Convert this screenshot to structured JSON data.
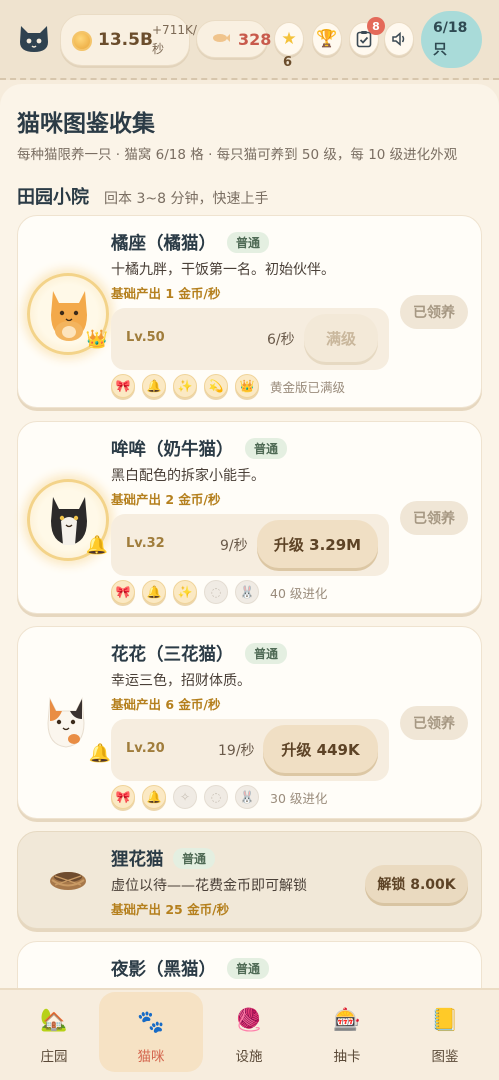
{
  "topbar": {
    "coins": "13.5B",
    "coin_rate_line1": "+711K/",
    "coin_rate_line2": "秒",
    "fish": "328",
    "star_count": "6",
    "task_badge": "8",
    "cattery_line1": "6/18",
    "cattery_line2": "只"
  },
  "page": {
    "title": "猫咪图鉴收集",
    "subtitle": "每种猫限养一只 · 猫窝 6/18 格 · 每只猫可养到 50 级，每 10 级进化外观"
  },
  "section": {
    "title": "田园小院",
    "subtitle": "回本 3~8 分钟，快速上手"
  },
  "cards": [
    {
      "name": "橘座（橘猫）",
      "tag": "普通",
      "desc": "十橘九胖，干饭第一名。初始伙伴。",
      "prod": "基础产出 1 金币/秒",
      "level": "Lv.50",
      "rate": "6/秒",
      "upgrade": "满级",
      "side": "已领养",
      "evo_note": "黄金版已满级"
    },
    {
      "name": "哞哞（奶牛猫）",
      "tag": "普通",
      "desc": "黑白配色的拆家小能手。",
      "prod": "基础产出 2 金币/秒",
      "level": "Lv.32",
      "rate": "9/秒",
      "upgrade": "升级 3.29M",
      "side": "已领养",
      "evo_note": "40 级进化"
    },
    {
      "name": "花花（三花猫）",
      "tag": "普通",
      "desc": "幸运三色，招财体质。",
      "prod": "基础产出 6 金币/秒",
      "level": "Lv.20",
      "rate": "19/秒",
      "upgrade": "升级 449K",
      "side": "已领养",
      "evo_note": "30 级进化"
    },
    {
      "name": "狸花猫",
      "tag": "普通",
      "desc": "虚位以待——花费金币即可解锁",
      "prod": "基础产出 25 金币/秒",
      "unlock": "解锁 8.00K"
    },
    {
      "name": "夜影（黑猫）",
      "tag": "普通"
    }
  ],
  "nav": {
    "items": [
      {
        "label": "庄园",
        "icon": "house-icon"
      },
      {
        "label": "猫咪",
        "icon": "paw-icon"
      },
      {
        "label": "设施",
        "icon": "yarn-icon"
      },
      {
        "label": "抽卡",
        "icon": "capsule-machine-icon"
      },
      {
        "label": "图鉴",
        "icon": "book-icon"
      }
    ],
    "active": "猫咪"
  },
  "colors": {
    "background": "#f6ecdc",
    "accent": "#d4674f",
    "gold_text": "#b5801e",
    "badge": "#e46a5a",
    "cattery_pill": "#a9dbd9"
  }
}
